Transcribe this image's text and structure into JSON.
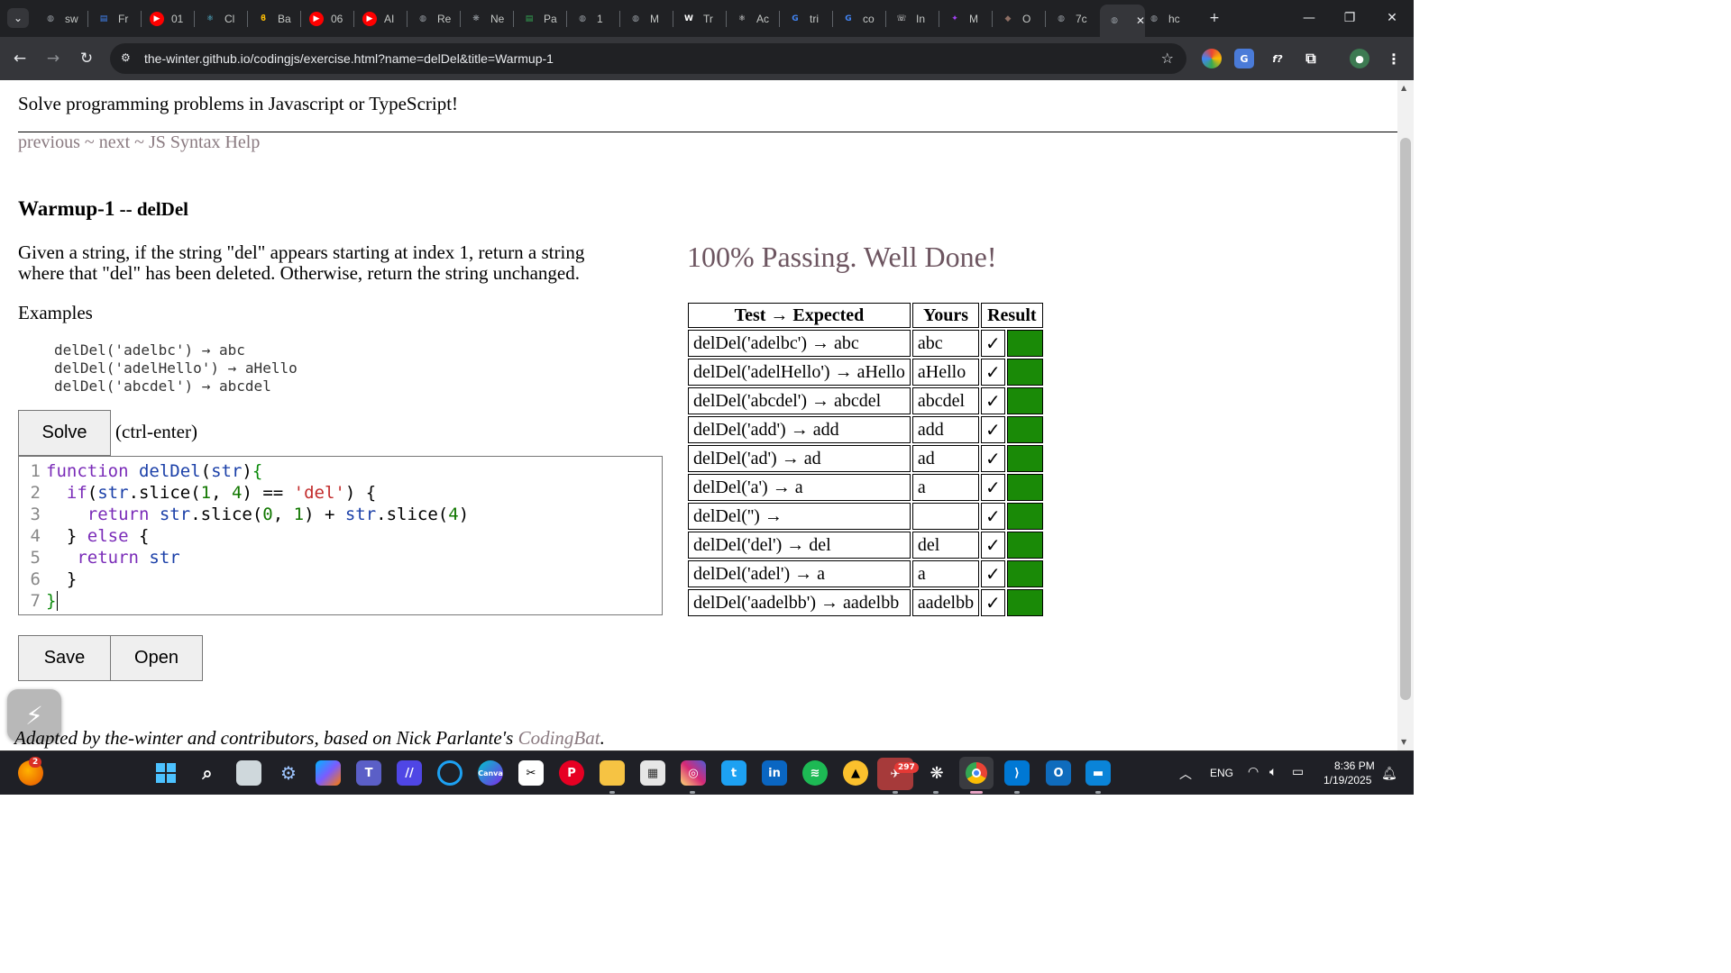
{
  "browser": {
    "tabs": [
      {
        "label": "sw",
        "fav": "globe",
        "color": "#9aa0a6"
      },
      {
        "label": "Fr",
        "fav": "doc",
        "color": "#4285f4"
      },
      {
        "label": "01",
        "fav": "youtube",
        "color": "#ff0000"
      },
      {
        "label": "Cl",
        "fav": "react",
        "color": "#61dafb"
      },
      {
        "label": "Ba",
        "fav": "bolt",
        "color": "#fbbc04"
      },
      {
        "label": "06",
        "fav": "youtube",
        "color": "#ff0000"
      },
      {
        "label": "AI",
        "fav": "youtube",
        "color": "#ff0000"
      },
      {
        "label": "Re",
        "fav": "globe",
        "color": "#9aa0a6"
      },
      {
        "label": "Ne",
        "fav": "openai",
        "color": "#9aa0a6"
      },
      {
        "label": "Pa",
        "fav": "doc",
        "color": "#34a853"
      },
      {
        "label": "1",
        "fav": "globe",
        "color": "#9aa0a6"
      },
      {
        "label": "M",
        "fav": "globe",
        "color": "#9aa0a6"
      },
      {
        "label": "Tr",
        "fav": "wiki",
        "color": "#ffffff"
      },
      {
        "label": "Ac",
        "fav": "react",
        "color": "#ffffff"
      },
      {
        "label": "tri",
        "fav": "google",
        "color": "#4285f4"
      },
      {
        "label": "co",
        "fav": "google",
        "color": "#4285f4"
      },
      {
        "label": "In",
        "fav": "phone",
        "color": "#ffffff"
      },
      {
        "label": "M",
        "fav": "gemini",
        "color": "#a142f4"
      },
      {
        "label": "O",
        "fav": "diamond",
        "color": "#8d6e63"
      },
      {
        "label": "7c",
        "fav": "globe",
        "color": "#9aa0a6"
      },
      {
        "label": "",
        "fav": "globe",
        "color": "#9aa0a6",
        "active": true
      },
      {
        "label": "hc",
        "fav": "globe",
        "color": "#9aa0a6"
      }
    ],
    "url": "the-winter.github.io/codingjs/exercise.html?name=delDel&title=Warmup-1"
  },
  "page": {
    "tagline": "Solve programming problems in Javascript or TypeScript!",
    "nav": {
      "previous": "previous",
      "sep": " ~ ",
      "next": "next",
      "help": "JS Syntax Help"
    },
    "title": "Warmup-1",
    "title_sep": " -- ",
    "problem_name": "delDel",
    "description": "Given a string, if the string \"del\" appears starting at index 1, return a string where that \"del\" has been deleted. Otherwise, return the string unchanged.",
    "examples_title": "Examples",
    "examples": "delDel('adelbc') → abc\ndelDel('adelHello') → aHello\ndelDel('abcdel') → abcdel",
    "solve_label": "Solve",
    "solve_hint": "(ctrl-enter)",
    "save_label": "Save",
    "open_label": "Open",
    "passing_text": "100% Passing. Well Done!",
    "table_headers": [
      "Test → Expected",
      "Yours",
      "Result"
    ],
    "results": [
      {
        "test": "delDel('adelbc') → abc",
        "yours": "abc",
        "mark": "✓"
      },
      {
        "test": "delDel('adelHello') → aHello",
        "yours": "aHello",
        "mark": "✓"
      },
      {
        "test": "delDel('abcdel') → abcdel",
        "yours": "abcdel",
        "mark": "✓"
      },
      {
        "test": "delDel('add') → add",
        "yours": "add",
        "mark": "✓"
      },
      {
        "test": "delDel('ad') → ad",
        "yours": "ad",
        "mark": "✓"
      },
      {
        "test": "delDel('a') → a",
        "yours": "a",
        "mark": "✓"
      },
      {
        "test": "delDel('') → ",
        "yours": "",
        "mark": "✓"
      },
      {
        "test": "delDel('del') → del",
        "yours": "del",
        "mark": "✓"
      },
      {
        "test": "delDel('adel') → a",
        "yours": "a",
        "mark": "✓"
      },
      {
        "test": "delDel('aadelbb') → aadelbb",
        "yours": "aadelbb",
        "mark": "✓"
      }
    ],
    "pass_color": "#1a8a07",
    "footer_text": "Adapted by the-winter and contributors, based on Nick Parlante's ",
    "footer_link": "CodingBat",
    "footer_end": "."
  },
  "code_lines": [
    "1",
    "2",
    "3",
    "4",
    "5",
    "6",
    "7"
  ],
  "taskbar": {
    "time": "8:36 PM",
    "date": "1/19/2025",
    "lang": "ENG",
    "telegram_badge": "297",
    "notif_badge": "2"
  }
}
